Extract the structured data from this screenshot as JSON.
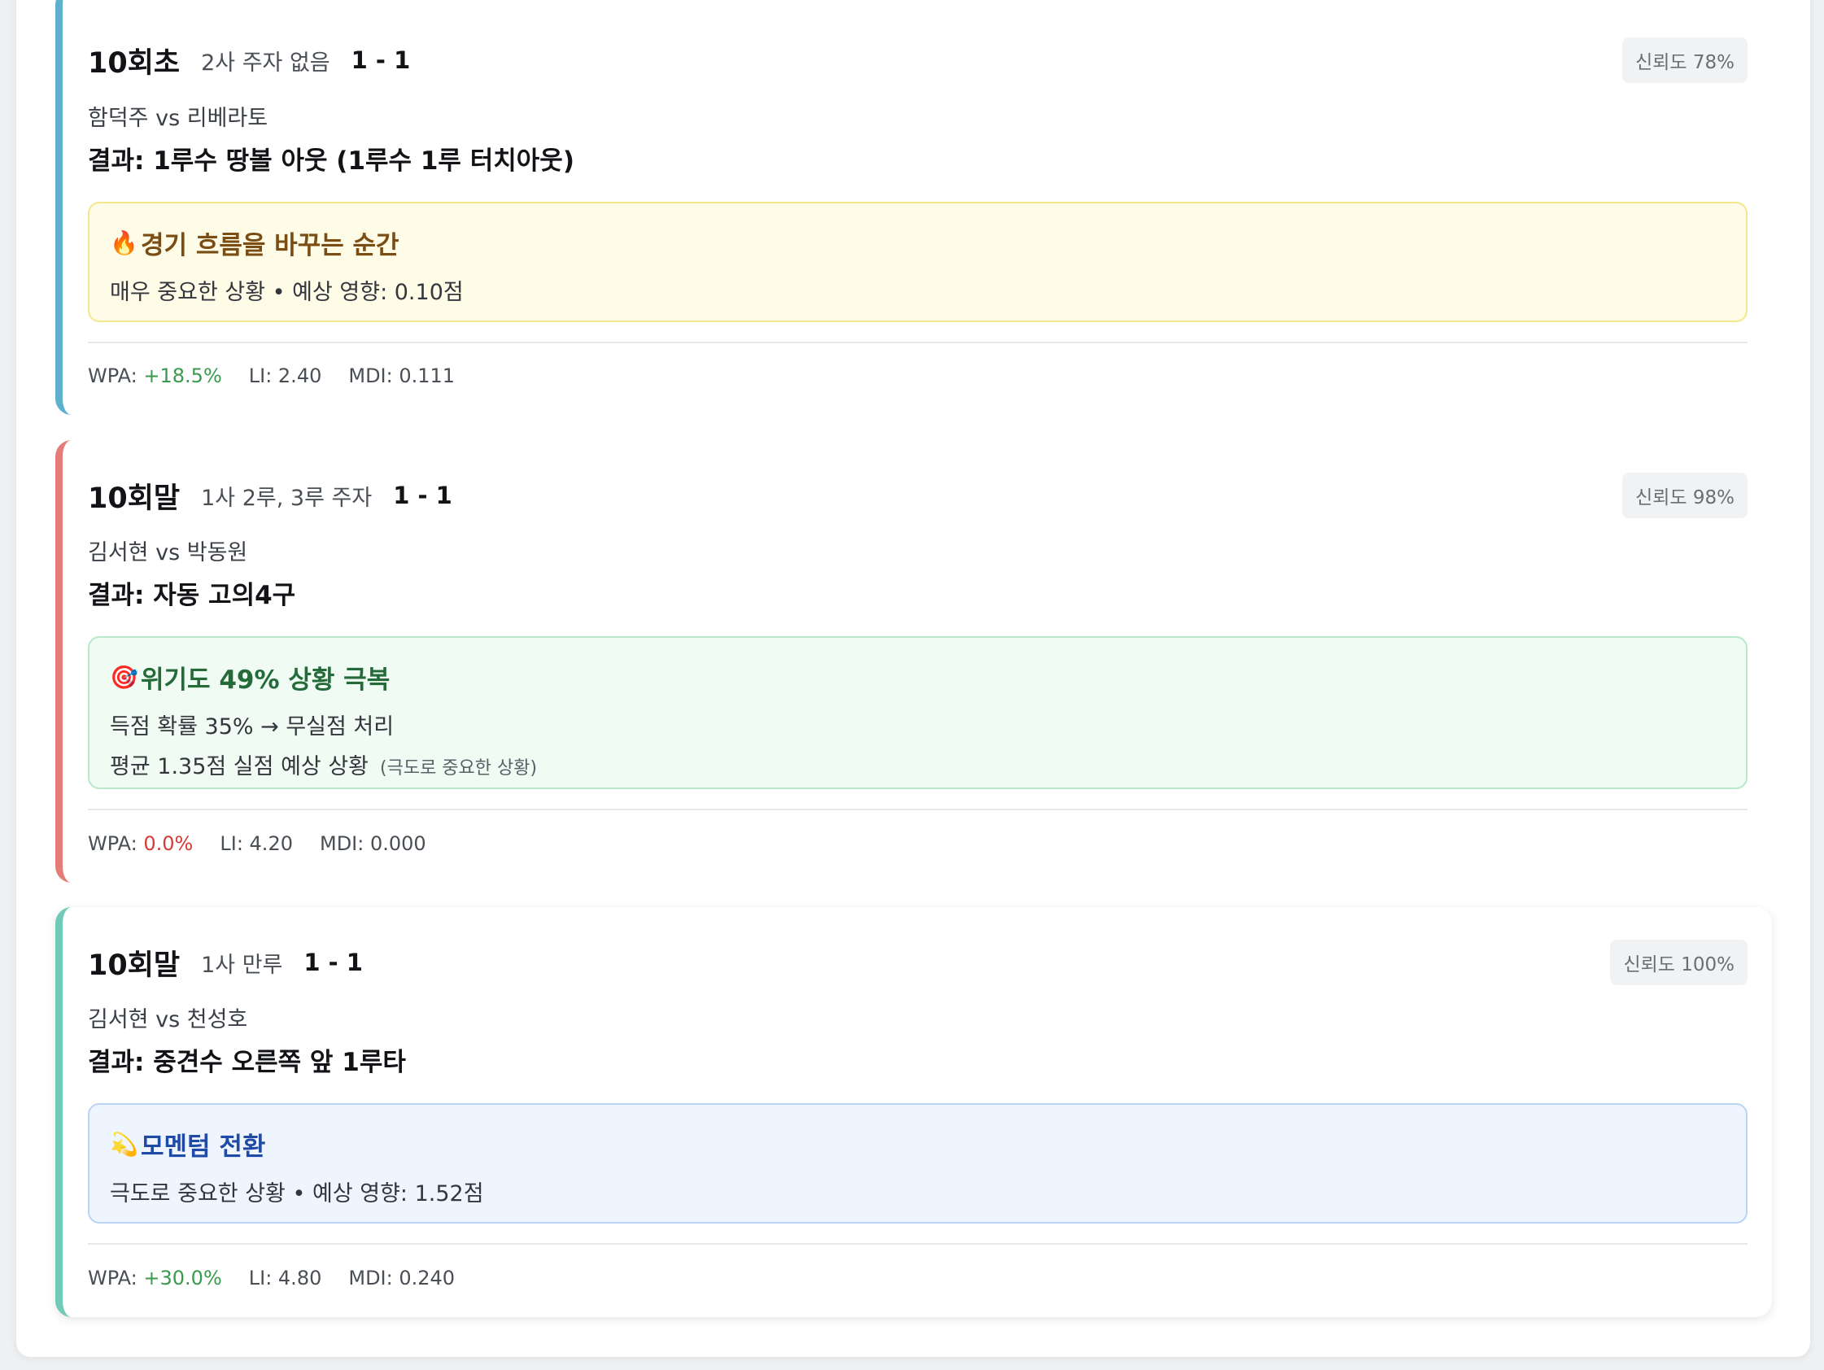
{
  "cards": [
    {
      "inning": "10회초",
      "situation": "2사 주자 없음",
      "score": "1 - 1",
      "confidence": "신뢰도 78%",
      "matchup": "함덕주 vs 리베라토",
      "result": "결과: 1루수 땅볼 아웃 (1루수 1루 터치아웃)",
      "highlight": {
        "icon": "fire-icon",
        "glyph": "🔥",
        "title": "경기 흐름을 바꾸는 순간",
        "line1": "매우 중요한 상황 • 예상 영향: 0.10점"
      },
      "stats": {
        "wpa_label": "WPA:",
        "wpa_value": "+18.5%",
        "li": "LI: 2.40",
        "mdi": "MDI: 0.111"
      },
      "accent_color": "#5fb0cd"
    },
    {
      "inning": "10회말",
      "situation": "1사 2루, 3루 주자",
      "score": "1 - 1",
      "confidence": "신뢰도 98%",
      "matchup": "김서현 vs 박동원",
      "result": "결과: 자동 고의4구",
      "highlight": {
        "icon": "target-icon",
        "glyph": "🎯",
        "title": "위기도 49% 상황 극복",
        "line1": "득점 확률 35% → 무실점 처리",
        "line2": "평균 1.35점 실점 예상 상황",
        "note": "(극도로 중요한 상황)"
      },
      "stats": {
        "wpa_label": "WPA:",
        "wpa_value": "0.0%",
        "li": "LI: 4.20",
        "mdi": "MDI: 0.000"
      },
      "accent_color": "#e47d78"
    },
    {
      "inning": "10회말",
      "situation": "1사 만루",
      "score": "1 - 1",
      "confidence": "신뢰도 100%",
      "matchup": "김서현 vs 천성호",
      "result": "결과: 중견수 오른쪽 앞 1루타",
      "highlight": {
        "icon": "dizzy-icon",
        "glyph": "💫",
        "title": "모멘텀 전환",
        "line1": "극도로 중요한 상황 • 예상 영향: 1.52점"
      },
      "stats": {
        "wpa_label": "WPA:",
        "wpa_value": "+30.0%",
        "li": "LI: 4.80",
        "mdi": "MDI: 0.240"
      },
      "accent_color": "#6fcab8"
    }
  ],
  "colors": {
    "positive": "#3a9a4e",
    "neutral_zero": "#d63b34"
  }
}
